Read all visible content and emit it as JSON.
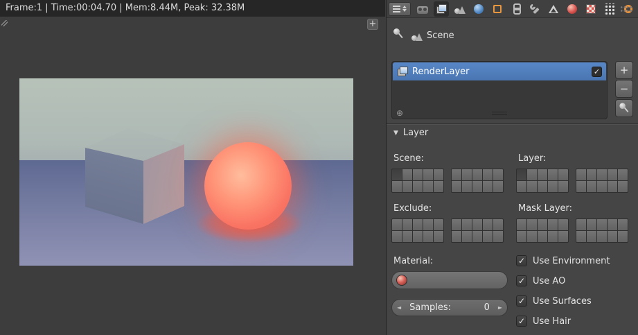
{
  "title_bar": {
    "text": "Frame:1 | Time:00:04.70 | Mem:8.44M, Peak: 32.38M"
  },
  "viewport": {
    "expand_button": "+"
  },
  "colors": {
    "selection_blue": "#4f7cba",
    "glow_red": "#ff5a3c",
    "panel_gray": "#454545"
  },
  "properties": {
    "editor_tabs": [
      {
        "id": "render",
        "active": false
      },
      {
        "id": "render-layers",
        "active": true
      },
      {
        "id": "scene",
        "active": false
      },
      {
        "id": "world",
        "active": false
      },
      {
        "id": "object",
        "active": false
      },
      {
        "id": "constraints",
        "active": false
      },
      {
        "id": "modifiers",
        "active": false
      },
      {
        "id": "object-data",
        "active": false
      },
      {
        "id": "material",
        "active": false
      },
      {
        "id": "texture",
        "active": false
      },
      {
        "id": "particles",
        "active": false
      },
      {
        "id": "physics",
        "active": false
      }
    ],
    "breadcrumb": {
      "label": "Scene"
    },
    "render_layer_list": {
      "items": [
        {
          "label": "RenderLayer",
          "checked": true,
          "selected": true
        }
      ],
      "add_label": "+",
      "remove_label": "−"
    },
    "layer_panel": {
      "title": "Layer",
      "collapse_arrow": "▼",
      "grids": [
        {
          "label": "Scene:",
          "selected": [
            0
          ]
        },
        {
          "label": "Layer:",
          "selected": [
            0
          ]
        },
        {
          "label": "Exclude:",
          "selected": []
        },
        {
          "label": "Mask Layer:",
          "selected": []
        }
      ],
      "material": {
        "label": "Material:"
      },
      "samples": {
        "label": "Samples:",
        "value": "0"
      },
      "options": [
        {
          "label": "Use Environment",
          "checked": true
        },
        {
          "label": "Use AO",
          "checked": true
        },
        {
          "label": "Use Surfaces",
          "checked": true
        },
        {
          "label": "Use Hair",
          "checked": true
        }
      ]
    }
  }
}
